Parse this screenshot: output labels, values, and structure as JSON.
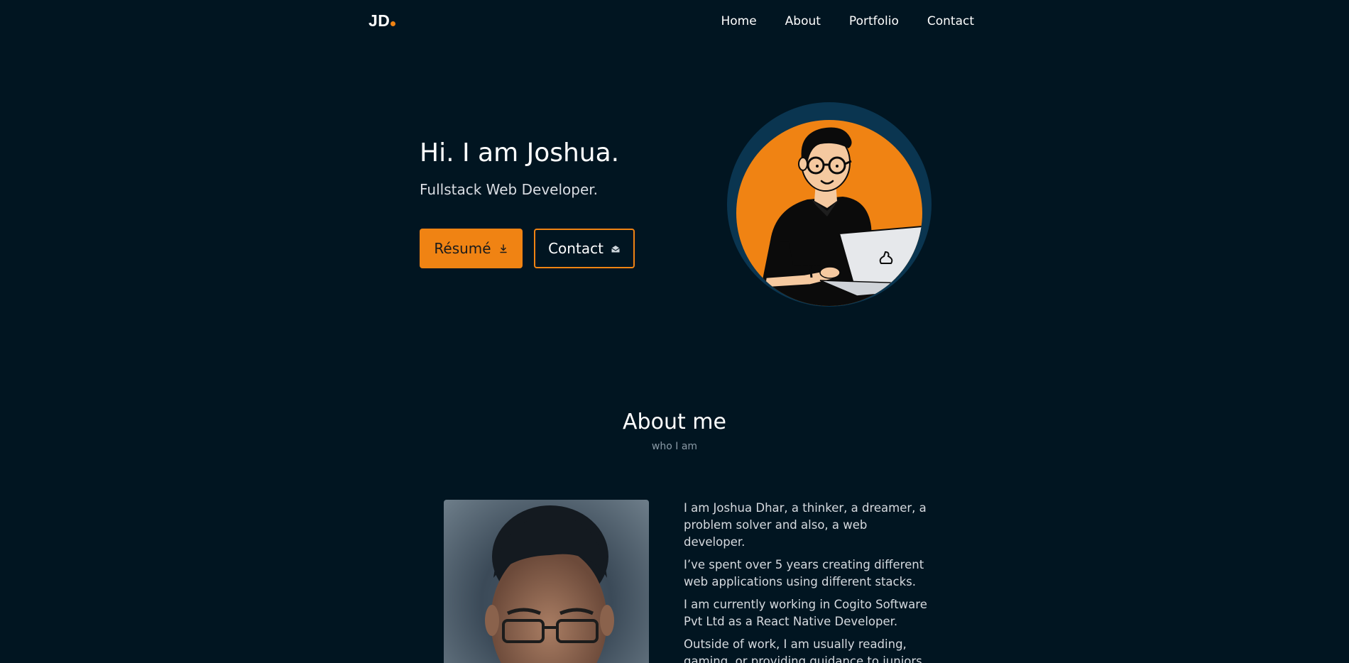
{
  "nav": {
    "logo_text": "JD",
    "links": [
      "Home",
      "About",
      "Portfolio",
      "Contact"
    ]
  },
  "hero": {
    "title": "Hi. I am Joshua.",
    "subtitle": "Fullstack Web Developer.",
    "resume_label": "Résumé",
    "contact_label": "Contact"
  },
  "about": {
    "title": "About me",
    "subtitle": "who I am",
    "paragraphs": [
      "I am Joshua Dhar, a thinker, a dreamer, a problem solver and also, a web developer.",
      "I’ve spent over 5 years creating different web applications using different stacks.",
      "I am currently working in Cogito Software Pvt Ltd as a React Native Developer.",
      "Outside of work, I am usually reading, gaming, or providing guidance to juniors."
    ]
  },
  "icons": {
    "resume": "download-icon",
    "contact": "mail-open-icon"
  },
  "colors": {
    "background": "#011521",
    "accent": "#f08313",
    "ring": "#0a3550",
    "text": "#ffffff",
    "muted": "#8a9aa6"
  }
}
